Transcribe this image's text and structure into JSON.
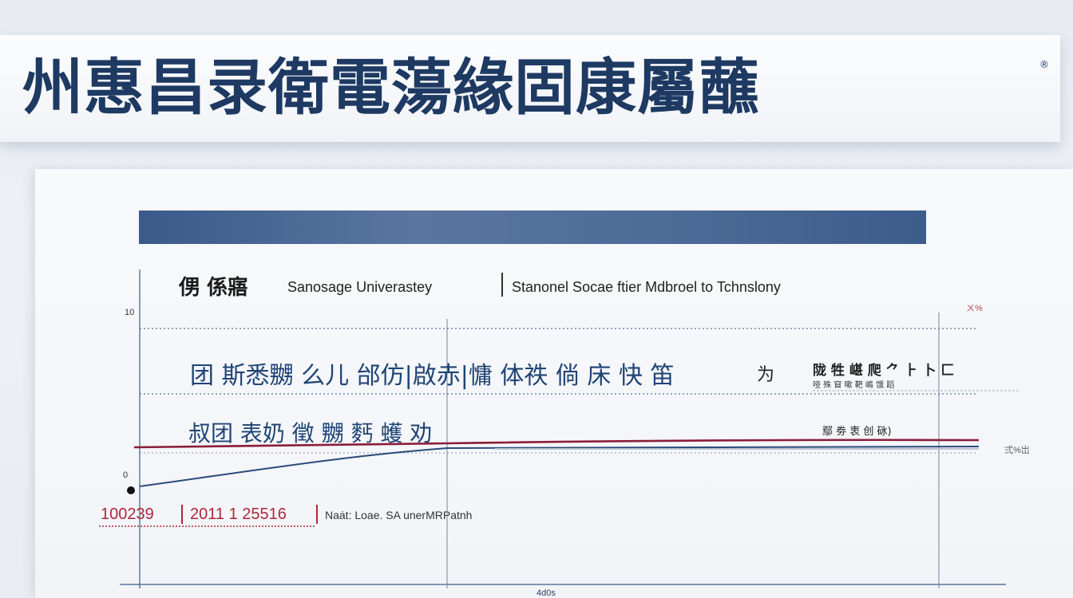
{
  "banner": {
    "title": "州惠昌录衛電蕩緣固康屬蘸",
    "mark": "®"
  },
  "card": {
    "logo_text": "侽 係寤",
    "university_name": "Sanosage Univerastey",
    "department_name": "Stanonel Socae ftier Mdbroel to Tchnslony",
    "headline_1": "团 斯悉嬲 么儿 邰仿|啟赤|慵 体祑 倘 床 快 笛",
    "headline_2": "叔团 表奶 徵 嬲 麫 蠖 劝",
    "side_mark": "为",
    "side_label_1": "陇 牲 嵁 爬 ⺈ ⺊ 卜 匚",
    "side_label_2": "哑 殊 窅 嗽 靶 嶋 饿 蹈",
    "side_label_3": "鄢 劵 衷 创 砯)",
    "ytick_top": "10",
    "ytick_bottom": "0",
    "xtick_bottom": "4d0s",
    "corner_top": "ㄨ%",
    "corner_mid": "弍%岀",
    "footer_code": "100239",
    "footer_date": "2011 1 25516",
    "footer_name": "Naȧt: Loae. SA unerMRPatnh"
  },
  "colors": {
    "banner_text": "#1e3a63",
    "header_bar": "#4c6a96",
    "navy_line": "#2a4a78",
    "crimson_line": "#8b1c3a",
    "footer_red": "#b0273b"
  }
}
